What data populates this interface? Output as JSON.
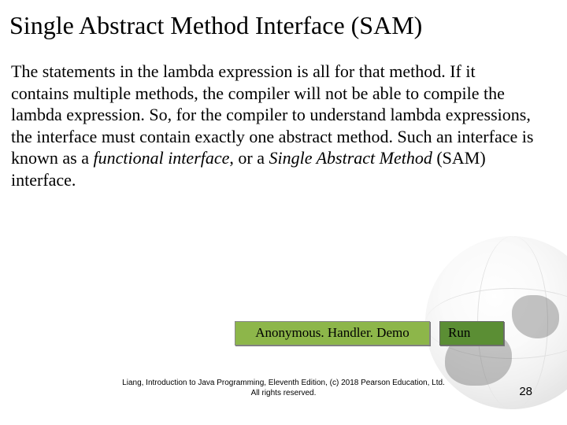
{
  "title": "Single Abstract Method Interface (SAM)",
  "body": {
    "pre": "The statements in the lambda expression is all for that method. If it contains multiple methods, the compiler will not be able to compile the lambda expression. So, for the compiler to understand lambda expressions, the interface must contain exactly one abstract method. Such an interface is known as a ",
    "em1": "functional interface",
    "mid": ", or a ",
    "em2": "Single Abstract Method",
    "post": " (SAM) interface."
  },
  "buttons": {
    "code_label": "Anonymous. Handler. Demo",
    "run_label": "Run"
  },
  "footer": {
    "line1": "Liang, Introduction to Java Programming, Eleventh Edition, (c) 2018 Pearson Education, Ltd.",
    "line2": "All rights reserved."
  },
  "page_number": "28"
}
